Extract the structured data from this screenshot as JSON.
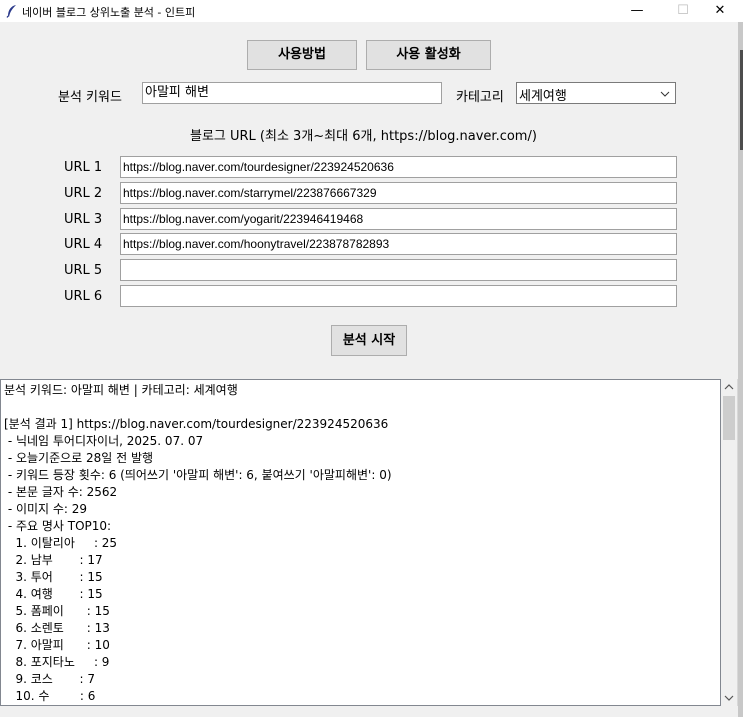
{
  "window": {
    "title": "네이버 블로그 상위노출 분석 - 인트피",
    "minimize_glyph": "—",
    "maximize_glyph": "☐",
    "close_glyph": "✕",
    "icon": "feather-icon"
  },
  "toolbar": {
    "usage_label": "사용방법",
    "activate_label": "사용 활성화"
  },
  "keyword": {
    "label": "분석 키워드",
    "value": "아말피 해변"
  },
  "category": {
    "label": "카테고리",
    "selected": "세계여행",
    "icon": "chevron-down-icon"
  },
  "url_section": {
    "header": "블로그 URL (최소 3개~최대 6개, https://blog.naver.com/)",
    "items": [
      {
        "label": "URL 1",
        "value": "https://blog.naver.com/tourdesigner/223924520636"
      },
      {
        "label": "URL 2",
        "value": "https://blog.naver.com/starrymel/223876667329"
      },
      {
        "label": "URL 3",
        "value": "https://blog.naver.com/yogarit/223946419468"
      },
      {
        "label": "URL 4",
        "value": "https://blog.naver.com/hoonytravel/223878782893"
      },
      {
        "label": "URL 5",
        "value": ""
      },
      {
        "label": "URL 6",
        "value": ""
      }
    ]
  },
  "start_label": "분석 시작",
  "results": {
    "lines": [
      "분석 키워드: 아말피 해변 | 카테고리: 세계여행",
      "",
      "[분석 결과 1] https://blog.naver.com/tourdesigner/223924520636",
      " - 닉네임 투어디자이너, 2025. 07. 07",
      " - 오늘기준으로 28일 전 발행",
      " - 키워드 등장 횟수: 6 (띄어쓰기 '아말피 해변': 6, 붙여쓰기 '아말피해변': 0)",
      " - 본문 글자 수: 2562",
      " - 이미지 수: 29",
      " - 주요 명사 TOP10:",
      "   1. 이탈리아     : 25",
      "   2. 남부       : 17",
      "   3. 투어       : 15",
      "   4. 여행       : 15",
      "   5. 폼페이      : 15",
      "   6. 소렌토      : 13",
      "   7. 아말피      : 10",
      "   8. 포지타노     : 9",
      "   9. 코스       : 7",
      "   10. 수        : 6"
    ]
  }
}
